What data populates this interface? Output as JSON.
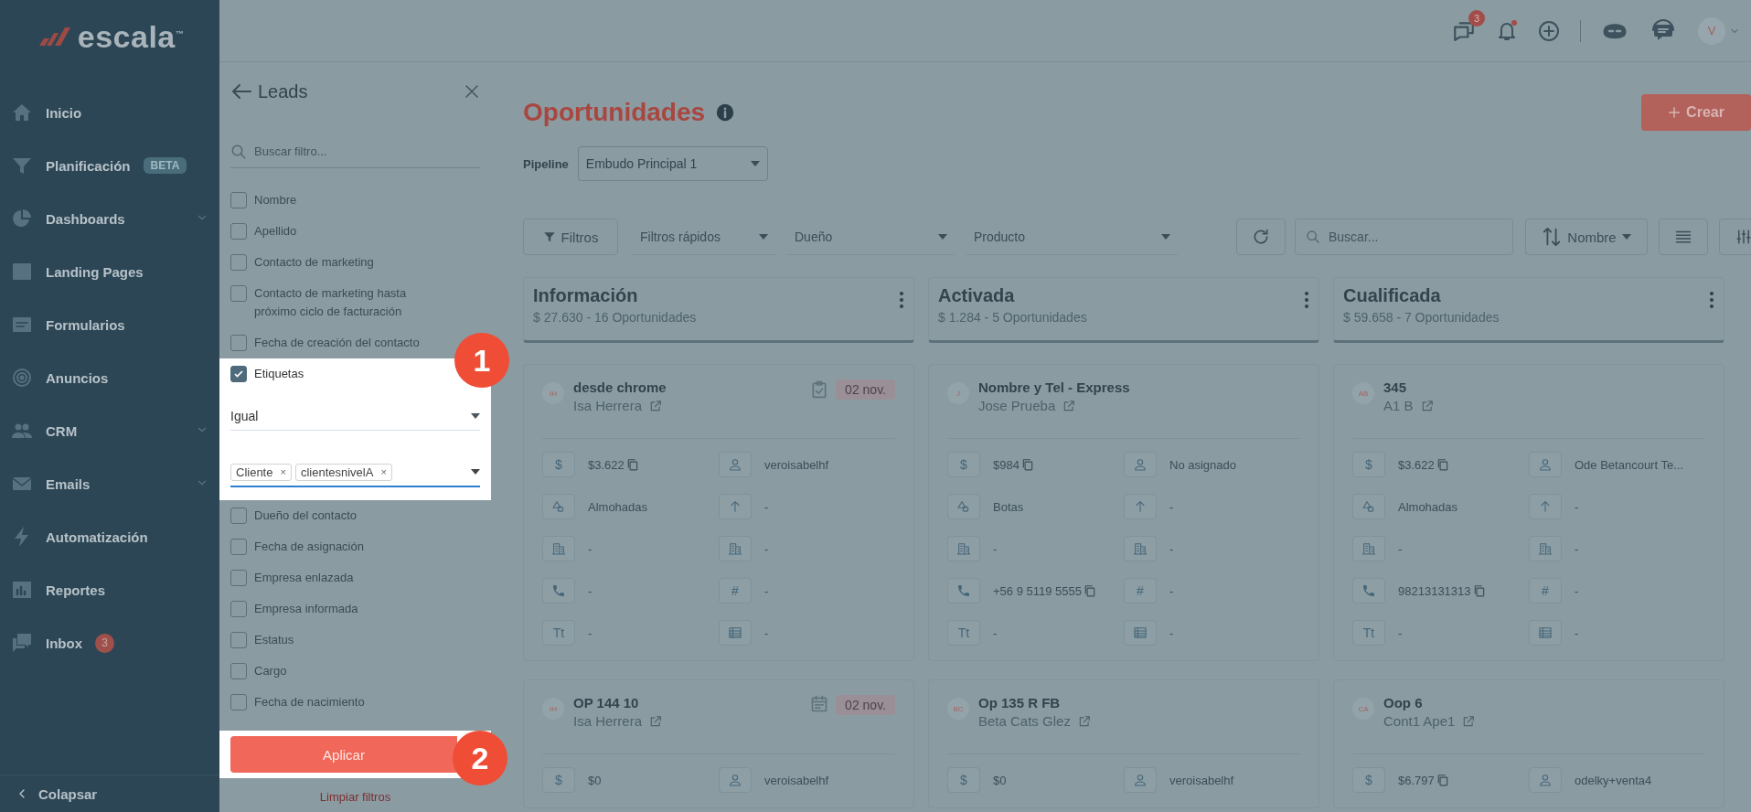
{
  "sidebar": {
    "logo": "escala",
    "logo_mark": "™",
    "items": [
      {
        "label": "Inicio",
        "kind": "home",
        "expandable": false
      },
      {
        "label": "Planificación",
        "kind": "funnel",
        "tag": "BETA",
        "expandable": false
      },
      {
        "label": "Dashboards",
        "kind": "pie",
        "expandable": true
      },
      {
        "label": "Landing Pages",
        "kind": "page",
        "expandable": false
      },
      {
        "label": "Formularios",
        "kind": "form",
        "expandable": false
      },
      {
        "label": "Anuncios",
        "kind": "target",
        "expandable": false
      },
      {
        "label": "CRM",
        "kind": "people",
        "expandable": true
      },
      {
        "label": "Emails",
        "kind": "mail",
        "expandable": true
      },
      {
        "label": "Automatización",
        "kind": "bolt",
        "expandable": false
      },
      {
        "label": "Reportes",
        "kind": "chart",
        "expandable": false
      },
      {
        "label": "Inbox",
        "kind": "chat",
        "badge": "3",
        "expandable": false
      }
    ],
    "collapse": "Colapsar"
  },
  "topbar": {
    "chat_badge": "3",
    "bell_dot": true,
    "avatar": "V"
  },
  "filter_panel": {
    "title": "Leads",
    "search_placeholder": "Buscar filtro...",
    "filters": [
      {
        "label": "Nombre",
        "checked": false
      },
      {
        "label": "Apellido",
        "checked": false
      },
      {
        "label": "Contacto de marketing",
        "checked": false
      },
      {
        "label": "Contacto de marketing hasta próximo ciclo de facturación",
        "checked": false
      },
      {
        "label": "Fecha de creación del contacto",
        "checked": false
      },
      {
        "label": "Etiquetas",
        "checked": true,
        "operator": "Igual",
        "tags": [
          {
            "label": "Cliente",
            "remove": "×"
          },
          {
            "label": "clientesnivelA",
            "remove": "×"
          }
        ],
        "step": "1"
      },
      {
        "label": "Dueño del contacto",
        "checked": false
      },
      {
        "label": "Fecha de asignación",
        "checked": false
      },
      {
        "label": "Empresa enlazada",
        "checked": false
      },
      {
        "label": "Empresa informada",
        "checked": false
      },
      {
        "label": "Estatus",
        "checked": false
      },
      {
        "label": "Cargo",
        "checked": false
      },
      {
        "label": "Fecha de nacimiento",
        "checked": false
      }
    ],
    "apply": "Aplicar",
    "apply_step": "2",
    "clear": "Limpiar filtros"
  },
  "main": {
    "title": "Oportunidades",
    "pipeline_label": "Pipeline",
    "pipeline": "Embudo Principal 1",
    "create": "Crear",
    "toolbar": {
      "filters": "Filtros",
      "dropdowns": [
        "Filtros rápidos",
        "Dueño",
        "Producto"
      ],
      "search_placeholder": "Buscar...",
      "sort": "Nombre"
    },
    "columns": [
      {
        "name": "Información",
        "summary": "$ 27.630 - 16 Oportunidades",
        "cards": [
          {
            "initials": "IH",
            "title": "desde chrome",
            "contact": "Isa Herrera",
            "date": {
              "text": "02 nov.",
              "kind": "task"
            },
            "fields": [
              {
                "kind": "money",
                "symbol": "$",
                "value": "$3.622",
                "copy": true
              },
              {
                "kind": "person",
                "value": "veroisabelhf",
                "copy": false
              },
              {
                "kind": "shapes",
                "value": "Almohadas",
                "copy": false
              },
              {
                "kind": "arrow",
                "value": "-",
                "copy": false
              },
              {
                "kind": "building",
                "value": "-",
                "copy": false
              },
              {
                "kind": "building",
                "value": "-",
                "copy": false
              },
              {
                "kind": "phone",
                "value": "-",
                "copy": false
              },
              {
                "kind": "hash",
                "symbol": "#",
                "value": "-",
                "copy": false
              },
              {
                "kind": "text",
                "symbol": "Tt",
                "value": "-",
                "copy": false
              },
              {
                "kind": "table",
                "value": "-",
                "copy": false
              }
            ]
          },
          {
            "initials": "IH",
            "title": "OP 144 10",
            "contact": "Isa Herrera",
            "date": {
              "text": "02 nov.",
              "kind": "calendar"
            },
            "fields": [
              {
                "kind": "money",
                "symbol": "$",
                "value": "$0",
                "copy": false
              },
              {
                "kind": "person",
                "value": "veroisabelhf",
                "copy": false
              }
            ]
          }
        ]
      },
      {
        "name": "Activada",
        "summary": "$ 1.284 - 5 Oportunidades",
        "cards": [
          {
            "initials": "J",
            "title": "Nombre y Tel - Express",
            "contact": "Jose Prueba",
            "fields": [
              {
                "kind": "money",
                "symbol": "$",
                "value": "$984",
                "copy": true
              },
              {
                "kind": "person",
                "value": "No asignado",
                "copy": false
              },
              {
                "kind": "shapes",
                "value": "Botas",
                "copy": false
              },
              {
                "kind": "arrow",
                "value": "-",
                "copy": false
              },
              {
                "kind": "building",
                "value": "-",
                "copy": false
              },
              {
                "kind": "building",
                "value": "-",
                "copy": false
              },
              {
                "kind": "phone",
                "value": "+56 9 5119 5555",
                "copy": true
              },
              {
                "kind": "hash",
                "symbol": "#",
                "value": "-",
                "copy": false
              },
              {
                "kind": "text",
                "symbol": "Tt",
                "value": "-",
                "copy": false
              },
              {
                "kind": "table",
                "value": "-",
                "copy": false
              }
            ]
          },
          {
            "initials": "BC",
            "title": "Op 135 R FB",
            "contact": "Beta Cats Glez",
            "fields": [
              {
                "kind": "money",
                "symbol": "$",
                "value": "$0",
                "copy": false
              },
              {
                "kind": "person",
                "value": "veroisabelhf",
                "copy": false
              }
            ]
          }
        ]
      },
      {
        "name": "Cualificada",
        "summary": "$ 59.658 - 7 Oportunidades",
        "cards": [
          {
            "initials": "AB",
            "title": "345",
            "contact": "A1 B",
            "fields": [
              {
                "kind": "money",
                "symbol": "$",
                "value": "$3.622",
                "copy": true
              },
              {
                "kind": "person",
                "value": "Ode Betancourt Te...",
                "copy": false
              },
              {
                "kind": "shapes",
                "value": "Almohadas",
                "copy": false
              },
              {
                "kind": "arrow",
                "value": "-",
                "copy": false
              },
              {
                "kind": "building",
                "value": "-",
                "copy": false
              },
              {
                "kind": "building",
                "value": "-",
                "copy": false
              },
              {
                "kind": "phone",
                "value": "98213131313",
                "copy": true
              },
              {
                "kind": "hash",
                "symbol": "#",
                "value": "-",
                "copy": false
              },
              {
                "kind": "text",
                "symbol": "Tt",
                "value": "-",
                "copy": false
              },
              {
                "kind": "table",
                "value": "-",
                "copy": false
              }
            ]
          },
          {
            "initials": "CA",
            "title": "Oop 6",
            "contact": "Cont1 Ape1",
            "fields": [
              {
                "kind": "money",
                "symbol": "$",
                "value": "$6.797",
                "copy": true
              },
              {
                "kind": "person",
                "value": "odelky+venta4",
                "copy": false
              }
            ]
          }
        ]
      }
    ]
  }
}
